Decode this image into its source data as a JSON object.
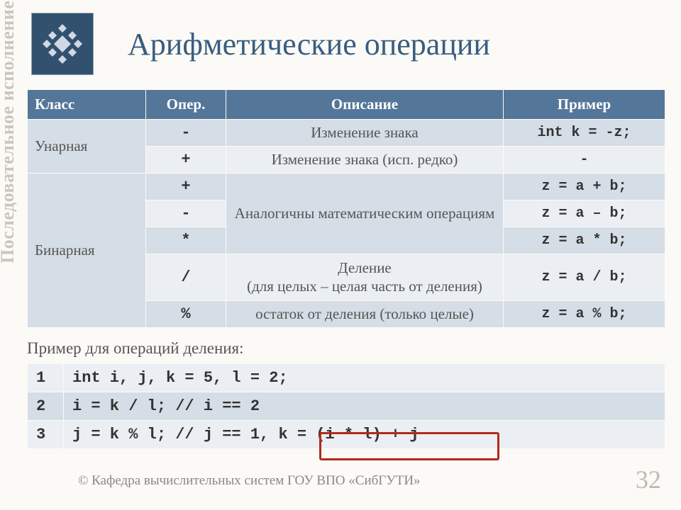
{
  "title": "Арифметические операции",
  "side_label": "Последовательное исполнение",
  "table": {
    "headers": {
      "klass": "Класс",
      "oper": "Опер.",
      "desc": "Описание",
      "example": "Пример"
    },
    "klass_unary": "Унарная",
    "klass_binary": "Бинарная",
    "rows": [
      {
        "op": "-",
        "desc": "Изменение знака",
        "ex": "int k = -z;"
      },
      {
        "op": "+",
        "desc": "Изменение знака (исп. редко)",
        "ex": "-"
      },
      {
        "op": "+",
        "desc": "",
        "ex": "z = a + b;"
      },
      {
        "op": "-",
        "desc": "Аналогичны математическим операциям",
        "ex": "z = a – b;"
      },
      {
        "op": "*",
        "desc": "",
        "ex": "z = a * b;"
      },
      {
        "op": "/",
        "desc": "Деление\n(для целых – целая часть от деления)",
        "ex": "z = a / b;"
      },
      {
        "op": "%",
        "desc": "остаток от деления (только целые)",
        "ex": "z = a % b;"
      }
    ]
  },
  "example_caption": "Пример для операций деления:",
  "code": [
    {
      "n": "1",
      "line": "int i, j, k = 5, l = 2;"
    },
    {
      "n": "2",
      "line": "i = k / l; // i == 2"
    },
    {
      "n": "3",
      "line": "j = k % l; // j == 1, k = (i * l) + j"
    }
  ],
  "footer": "© Кафедра вычислительных систем ГОУ ВПО «СибГУТИ»",
  "page": "32"
}
